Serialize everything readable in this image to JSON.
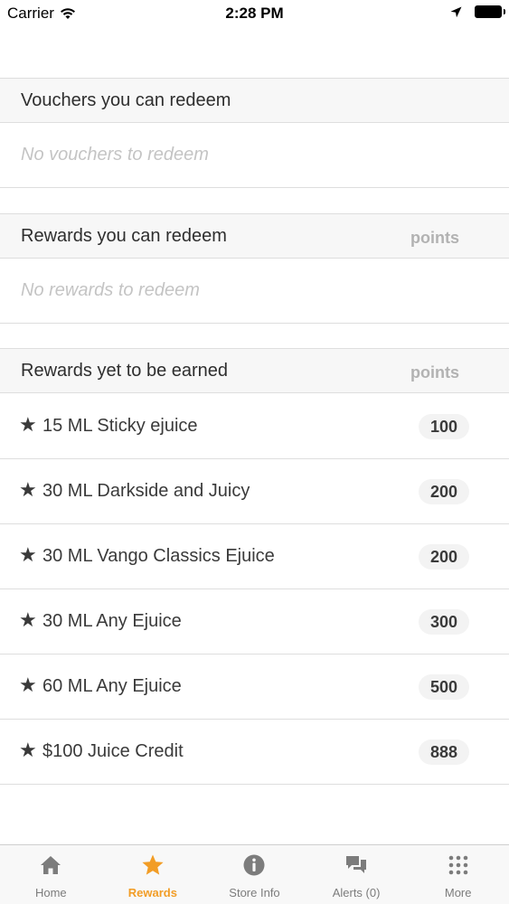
{
  "status_bar": {
    "carrier": "Carrier",
    "time": "2:28 PM"
  },
  "vouchers": {
    "title": "Vouchers you can redeem",
    "empty_text": "No vouchers to redeem"
  },
  "rewards_redeem": {
    "title": "Rewards you can redeem",
    "points_label": "points",
    "empty_text": "No rewards to redeem"
  },
  "rewards_earn": {
    "title": "Rewards yet to be earned",
    "points_label": "points",
    "items": [
      {
        "star": "★",
        "name": "15 ML Sticky ejuice",
        "points": "100"
      },
      {
        "star": "★",
        "name": "30 ML Darkside and Juicy",
        "points": "200"
      },
      {
        "star": "★",
        "name": "30 ML Vango Classics Ejuice",
        "points": "200"
      },
      {
        "star": "★",
        "name": "30 ML Any Ejuice",
        "points": "300"
      },
      {
        "star": "★",
        "name": "60 ML Any Ejuice",
        "points": "500"
      },
      {
        "star": "★",
        "name": "$100 Juice Credit",
        "points": "888"
      }
    ]
  },
  "tab_bar": {
    "tabs": [
      {
        "label": "Home",
        "icon": "home-icon"
      },
      {
        "label": "Rewards",
        "icon": "star-icon",
        "active": true
      },
      {
        "label": "Store Info",
        "icon": "info-icon"
      },
      {
        "label": "Alerts (0)",
        "icon": "chat-bubbles-icon"
      },
      {
        "label": "More",
        "icon": "grid-dots-icon"
      }
    ],
    "active_color": "#f29d26",
    "inactive_color": "#7c7c7c"
  }
}
